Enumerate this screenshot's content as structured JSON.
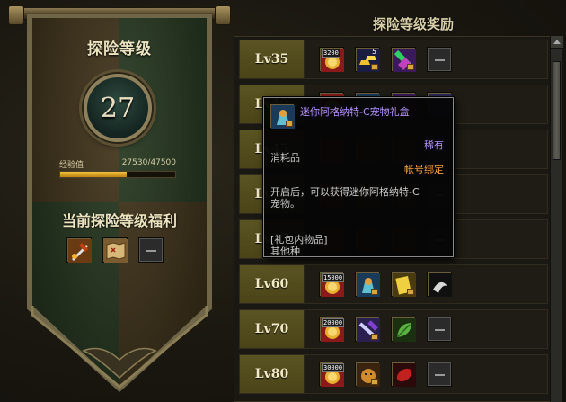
{
  "banner": {
    "title": "探险等级",
    "level": "27",
    "exp_label": "经验值",
    "exp_value": "27530/47500",
    "exp_progress": 0.58,
    "benefit_title": "当前探险等级福利",
    "benefit_icons": [
      "sword-buff-icon",
      "treasure-map-icon",
      "empty-slot"
    ]
  },
  "rewards": {
    "title": "探险等级奖励",
    "rows": [
      {
        "level": "Lv35",
        "items": [
          {
            "icon": "gold-pouch-icon",
            "qty": "3200"
          },
          {
            "icon": "gold-bars-icon",
            "qty": "5"
          },
          {
            "icon": "costume-box-icon",
            "qty": ""
          },
          {
            "icon": "empty-slot",
            "qty": ""
          }
        ]
      },
      {
        "level": "Lv40",
        "items": []
      },
      {
        "level": "Lv45",
        "items": []
      },
      {
        "level": "Lv50",
        "items": []
      },
      {
        "level": "Lv55",
        "items": []
      },
      {
        "level": "Lv60",
        "items": [
          {
            "icon": "gold-pouch-icon",
            "qty": "15000"
          },
          {
            "icon": "pet-gift-box-icon",
            "qty": ""
          },
          {
            "icon": "gold-card-icon",
            "qty": ""
          },
          {
            "icon": "dark-claw-icon",
            "qty": ""
          }
        ]
      },
      {
        "level": "Lv70",
        "items": [
          {
            "icon": "gold-pouch-icon",
            "qty": "20000"
          },
          {
            "icon": "purple-sword-icon",
            "qty": ""
          },
          {
            "icon": "green-leaf-icon",
            "qty": ""
          },
          {
            "icon": "empty-slot",
            "qty": ""
          }
        ]
      },
      {
        "level": "Lv80",
        "items": [
          {
            "icon": "gold-pouch-icon",
            "qty": "30000"
          },
          {
            "icon": "pet-tiger-icon",
            "qty": ""
          },
          {
            "icon": "red-gem-icon",
            "qty": ""
          },
          {
            "icon": "empty-slot",
            "qty": ""
          }
        ]
      }
    ]
  },
  "tooltip": {
    "name": "迷你阿格纳特-C宠物礼盒",
    "rarity": "稀有",
    "type": "消耗品",
    "bind": "帐号绑定",
    "desc_line1": "开启后，可以获得迷你阿格纳特-C",
    "desc_line2": "宠物。",
    "category": "[礼包内物品]",
    "sub": "其他种"
  },
  "colors": {
    "level_cell": "#5a5322",
    "tooltip_name": "#b592ff",
    "tooltip_bind": "#f0a040",
    "exp_fill": "#f0c040"
  }
}
